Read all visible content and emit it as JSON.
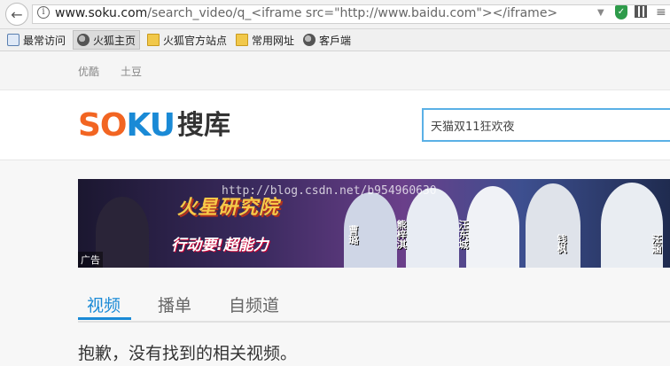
{
  "browser": {
    "url_host": "www.soku.com",
    "url_rest": "/search_video/q_<iframe src=\"http://www.baidu.com\"></iframe>",
    "info_icon": "i"
  },
  "bookmarks": [
    {
      "label": "最常访问",
      "icon": "search-icon"
    },
    {
      "label": "火狐主页",
      "icon": "globe-icon"
    },
    {
      "label": "火狐官方站点",
      "icon": "folder-icon"
    },
    {
      "label": "常用网址",
      "icon": "folder-icon"
    },
    {
      "label": "客戶端",
      "icon": "globe-icon"
    }
  ],
  "top_links": [
    "优酷",
    "土豆"
  ],
  "logo": {
    "so": "SO",
    "ku": "KU",
    "cn": "搜库"
  },
  "search": {
    "value": "天猫双11狂欢夜"
  },
  "banner": {
    "title": "火星研究院",
    "slogan": "行动要!超能力",
    "cast": [
      "曹璐",
      "熊梓淇",
      "汪东城",
      "钱枫",
      "汪涵"
    ],
    "watermark": "http://blog.csdn.net/b954960630",
    "ad_label": "广告"
  },
  "tabs": [
    "视频",
    "播单",
    "自频道"
  ],
  "message": "抱歉，没有找到的相关视频。",
  "colors": {
    "accent": "#1a8ad6",
    "logo_orange": "#f26522"
  }
}
